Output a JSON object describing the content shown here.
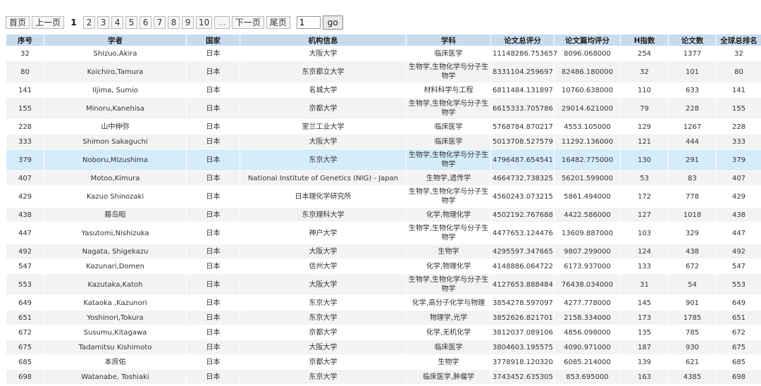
{
  "pager": {
    "first": "首页",
    "prev": "上一页",
    "current": "1",
    "pages": [
      "2",
      "3",
      "4",
      "5",
      "6",
      "7",
      "8",
      "9",
      "10"
    ],
    "ellipsis": "...",
    "next": "下一页",
    "last": "尾页",
    "jump_value": "1",
    "go": "go"
  },
  "table": {
    "headers": [
      "序号",
      "学者",
      "国家",
      "机构信息",
      "学科",
      "论文总评分",
      "论文篇均评分",
      "H指数",
      "论文数",
      "全球总排名"
    ],
    "highlight_row": 6,
    "rows": [
      {
        "no": "32",
        "name": "Shizuo,Akira",
        "country": "日本",
        "inst": "大阪大学",
        "subject": "临床医学",
        "total": "11148286.753657",
        "avg": "8096.068000",
        "h": "254",
        "papers": "1377",
        "rank": "32"
      },
      {
        "no": "80",
        "name": "Koichiro,Tamura",
        "country": "日本",
        "inst": "东京都立大学",
        "subject": "生物学,生物化学与分子生物学",
        "total": "8331104.259697",
        "avg": "82486.180000",
        "h": "32",
        "papers": "101",
        "rank": "80"
      },
      {
        "no": "141",
        "name": "Iijima, Sumio",
        "country": "日本",
        "inst": "名城大学",
        "subject": "材料科学与工程",
        "total": "6811484.131897",
        "avg": "10760.638000",
        "h": "110",
        "papers": "633",
        "rank": "141"
      },
      {
        "no": "155",
        "name": "Minoru,Kanehisa",
        "country": "日本",
        "inst": "京都大学",
        "subject": "生物学,生物化学与分子生物学",
        "total": "6615333.705786",
        "avg": "29014.621000",
        "h": "79",
        "papers": "228",
        "rank": "155"
      },
      {
        "no": "228",
        "name": "山中伸弥",
        "country": "日本",
        "inst": "室兰工业大学",
        "subject": "临床医学",
        "total": "5768784.870217",
        "avg": "4553.105000",
        "h": "129",
        "papers": "1267",
        "rank": "228"
      },
      {
        "no": "333",
        "name": "Shimon Sakaguchi",
        "country": "日本",
        "inst": "大阪大学",
        "subject": "临床医学",
        "total": "5013708.527579",
        "avg": "11292.136000",
        "h": "121",
        "papers": "444",
        "rank": "333"
      },
      {
        "no": "379",
        "name": "Noboru,Mizushima",
        "country": "日本",
        "inst": "东京大学",
        "subject": "生物学,生物化学与分子生物学",
        "total": "4796487.654541",
        "avg": "16482.775000",
        "h": "130",
        "papers": "291",
        "rank": "379"
      },
      {
        "no": "407",
        "name": "Motoo,Kimura",
        "country": "日本",
        "inst": "National Institute of Genetics (NIG) - Japan",
        "subject": "生物学,遗传学",
        "total": "4664732.738325",
        "avg": "56201.599000",
        "h": "53",
        "papers": "83",
        "rank": "407"
      },
      {
        "no": "429",
        "name": "Kazuo Shinozaki",
        "country": "日本",
        "inst": "日本理化学研究所",
        "subject": "生物学,生物化学与分子生物学",
        "total": "4560243.073215",
        "avg": "5861.494000",
        "h": "172",
        "papers": "778",
        "rank": "429"
      },
      {
        "no": "438",
        "name": "藤岛昭",
        "country": "日本",
        "inst": "东京理科大学",
        "subject": "化学,物理化学",
        "total": "4502192.767688",
        "avg": "4422.586000",
        "h": "127",
        "papers": "1018",
        "rank": "438"
      },
      {
        "no": "447",
        "name": "Yasutomi,Nishizuka",
        "country": "日本",
        "inst": "神户大学",
        "subject": "生物学,生物化学与分子生物学",
        "total": "4477653.124476",
        "avg": "13609.887000",
        "h": "103",
        "papers": "329",
        "rank": "447"
      },
      {
        "no": "492",
        "name": "Nagata, Shigekazu",
        "country": "日本",
        "inst": "大阪大学",
        "subject": "生物学",
        "total": "4295597.347665",
        "avg": "9807.299000",
        "h": "124",
        "papers": "438",
        "rank": "492"
      },
      {
        "no": "547",
        "name": "Kazunari,Domen",
        "country": "日本",
        "inst": "信州大学",
        "subject": "化学,物理化学",
        "total": "4148886.064722",
        "avg": "6173.937000",
        "h": "133",
        "papers": "672",
        "rank": "547"
      },
      {
        "no": "553",
        "name": "Kazutaka,Katoh",
        "country": "日本",
        "inst": "大阪大学",
        "subject": "生物学,生物化学与分子生物学",
        "total": "4127653.888484",
        "avg": "76438.034000",
        "h": "31",
        "papers": "54",
        "rank": "553"
      },
      {
        "no": "649",
        "name": "Kataoka ,Kazunori",
        "country": "日本",
        "inst": "东京大学",
        "subject": "化学,高分子化学与物理",
        "total": "3854278.597097",
        "avg": "4277.778000",
        "h": "145",
        "papers": "901",
        "rank": "649"
      },
      {
        "no": "651",
        "name": "Yoshinori,Tokura",
        "country": "日本",
        "inst": "东京大学",
        "subject": "物理学,光学",
        "total": "3852626.821701",
        "avg": "2158.334000",
        "h": "173",
        "papers": "1785",
        "rank": "651"
      },
      {
        "no": "672",
        "name": "Susumu,Kitagawa",
        "country": "日本",
        "inst": "京都大学",
        "subject": "化学,无机化学",
        "total": "3812037.089106",
        "avg": "4856.098000",
        "h": "135",
        "papers": "785",
        "rank": "672"
      },
      {
        "no": "675",
        "name": "Tadamitsu Kishimoto",
        "country": "日本",
        "inst": "大阪大学",
        "subject": "临床医学",
        "total": "3804603.195575",
        "avg": "4090.971000",
        "h": "187",
        "papers": "930",
        "rank": "675"
      },
      {
        "no": "685",
        "name": "本庶佑",
        "country": "日本",
        "inst": "京都大学",
        "subject": "生物学",
        "total": "3778918.120320",
        "avg": "6085.214000",
        "h": "139",
        "papers": "621",
        "rank": "685"
      },
      {
        "no": "698",
        "name": "Watanabe, Toshiaki",
        "country": "日本",
        "inst": "东京大学",
        "subject": "临床医学,肿瘤学",
        "total": "3743452.635305",
        "avg": "853.695000",
        "h": "163",
        "papers": "4385",
        "rank": "698"
      }
    ]
  }
}
